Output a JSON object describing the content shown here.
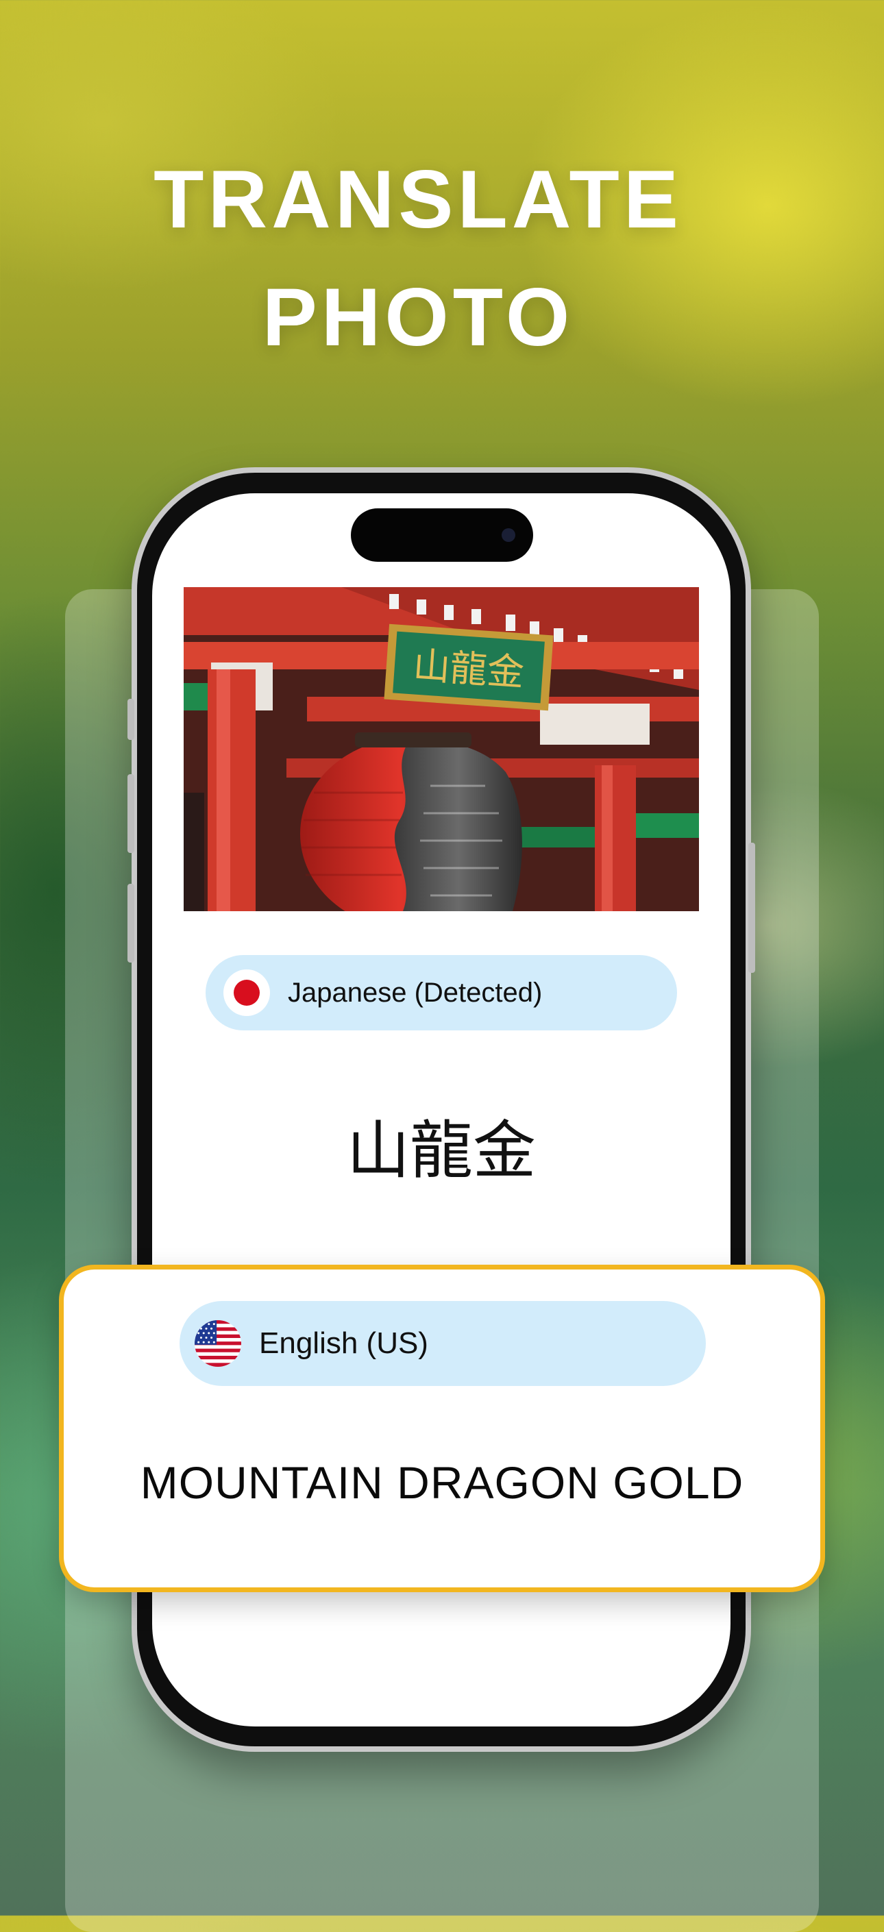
{
  "headline": {
    "line1": "TRANSLATE",
    "line2": "PHOTO"
  },
  "source": {
    "language_label": "Japanese (Detected)",
    "flag_icon": "japan-flag-icon",
    "text": "山龍金"
  },
  "target": {
    "language_label": "English (US)",
    "flag_icon": "us-flag-icon",
    "text": "MOUNTAIN DRAGON GOLD"
  },
  "photo": {
    "sign_text": "山龍金"
  },
  "colors": {
    "pill_background": "#d2ecfb",
    "card_border": "#f2b61f",
    "headline": "#ffffff"
  }
}
